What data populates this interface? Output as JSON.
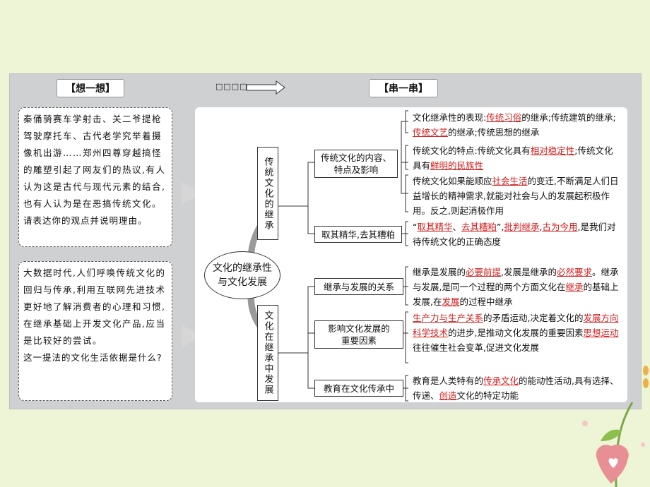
{
  "header": {
    "left_title": "【想一想】",
    "arrow_label": "□□□□",
    "right_title": "【串一串】"
  },
  "questions": {
    "q1_text": "秦俑骑赛车学射击、关二爷提枪驾驶摩托车、古代老学究举着摄像机出游……郑州四尊穿越搞怪的雕塑引起了网友们的热议,有人认为这是古代与现代元素的结合,也有人认为是在恶搞传统文化。",
    "q1_ask": "请表达你的观点并说明理由。",
    "q2_text": "大数据时代,人们呼唤传统文化的回归与传承,利用互联网先进技术更好地了解消费者的心理和习惯,在继承基础上开发文化产品,应当是比较好的尝试。",
    "q2_ask": "这一提法的文化生活依据是什么?"
  },
  "mindmap": {
    "center": "文化的继承性与文化发展",
    "branch_top": "传统文化的继承",
    "branch_bottom": "文化在继承中发展",
    "n_content": "传统文化的内容、特点及影响",
    "n_essence": "取其精华,去其糟粕",
    "n_relation": "继承与发展的关系",
    "n_factors": "影响文化发展的重要因素",
    "n_education": "教育在文化传承中",
    "t1": {
      "a": "文化继承性的表现:",
      "r1": "传统习俗",
      "b": "的继承;传统建筑的继承;",
      "r2": "传统文艺",
      "c": "的继承;传统思想的继承"
    },
    "t2": {
      "a": "传统文化的特点:传统文化具有",
      "r1": "相对稳定性",
      "b": ";传统文化具有",
      "r2": "鲜明的民族性"
    },
    "t3": {
      "a": "传统文化如果能顺应",
      "r1": "社会生活",
      "b": "的变迁,不断满足人们日益增长的精神需求,就能对社会与人的发展起积极作用。反之,则起消极作用"
    },
    "t4": {
      "q1": "“",
      "r1": "取其精华",
      "s1": "、",
      "r2": "去其糟粕",
      "q2": "”,",
      "r3": "批判继承",
      "s2": ",",
      "r4": "古为今用",
      "b": ",是我们对待传统文化的正确态度"
    },
    "t5": {
      "a": "继承是发展的",
      "r1": "必要前提",
      "b": ",发展是继承的",
      "r2": "必然要求",
      "c": "。继承与发展,是同一个过程的两个方面文化在",
      "r3": "继承",
      "d": "的基础上发展,在",
      "r4": "发展",
      "e": "的过程中继承"
    },
    "t6": {
      "r1": "生产力与生产关系",
      "a": "的矛盾运动,决定着文化的",
      "r2": "发展方向",
      "r3": "科学技术",
      "b": "的进步,是推动文化发展的重要因素",
      "r4": "思想运动",
      "c": "往往催生社会变革,促进文化发展"
    },
    "t7": {
      "a": "教育是人类特有的",
      "r1": "传承文化",
      "b": "的能动性活动,具有选择、传递、",
      "r2": "创造",
      "c": "文化的特定功能"
    }
  },
  "colors": {
    "accent_red": "#d41e1e",
    "background": "#eef5d6",
    "panel": "#cfd0d2"
  }
}
